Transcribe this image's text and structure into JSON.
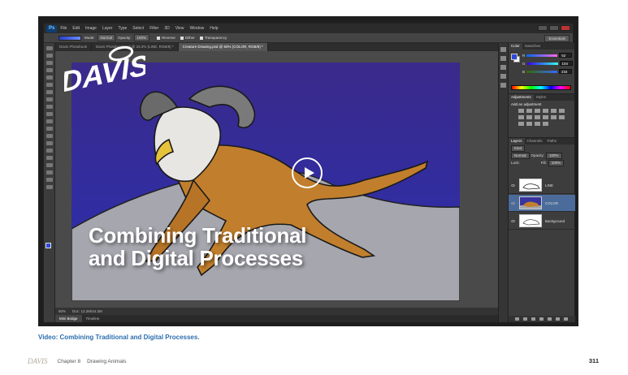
{
  "photoshop": {
    "app_logo": "Ps",
    "menu": [
      "File",
      "Edit",
      "Image",
      "Layer",
      "Type",
      "Select",
      "Filter",
      "3D",
      "View",
      "Window",
      "Help"
    ],
    "options_bar": {
      "mode_label": "Mode:",
      "mode_value": "Normal",
      "opacity_label": "Opacity:",
      "opacity_value": "100%",
      "reverse": "Reverse",
      "dither": "Dither",
      "transparency": "Transparency",
      "workspace": "Essentials"
    },
    "doc_tabs": [
      {
        "label": "Davis Photobook",
        "active": false
      },
      {
        "label": "Davis Photobook.psd @ 33.3% (LINE, RGB/8) *",
        "active": false
      },
      {
        "label": "Creature Drawing.psd @ 50% (COLOR, RGB/8) *",
        "active": true
      }
    ],
    "status": {
      "zoom": "50%",
      "doc_size": "Doc: 12.2M/44.3M"
    },
    "bottom_tabs": [
      "Mini Bridge",
      "Timeline"
    ],
    "panels": {
      "color_tabs": [
        "Color",
        "Swatches"
      ],
      "color_values": {
        "r": "52",
        "g": "104",
        "b": "234"
      },
      "adjustment_tabs": [
        "Adjustments",
        "Styles"
      ],
      "adjustment_title": "Add an adjustment",
      "layers_tabs": [
        "Layers",
        "Channels",
        "Paths"
      ],
      "kind_label": "Kind",
      "blend_mode": "Normal",
      "opacity_label": "Opacity:",
      "opacity_value": "100%",
      "lock_label": "Lock:",
      "fill_label": "Fill:",
      "fill_value": "100%",
      "layers": [
        {
          "name": "LINE",
          "selected": false
        },
        {
          "name": "COLOR",
          "selected": true
        },
        {
          "name": "Background",
          "selected": false
        }
      ]
    }
  },
  "overlay": {
    "brand": "DAVIS",
    "title_line1": "Combining Traditional",
    "title_line2": "and Digital Processes"
  },
  "page": {
    "caption": "Video: Combining Traditional and Digital Processes.",
    "footer_logo": "DAVIS",
    "chapter": "Chapter 8",
    "chapter_title": "Drawing Animals",
    "page_number": "311"
  },
  "colors": {
    "canvas_sky_top": "#3a2a8a",
    "canvas_sky_bottom": "#2b2fb0",
    "ground": "#a6a6ae",
    "foreground": "#2f48d9",
    "caption": "#2b6dad"
  }
}
